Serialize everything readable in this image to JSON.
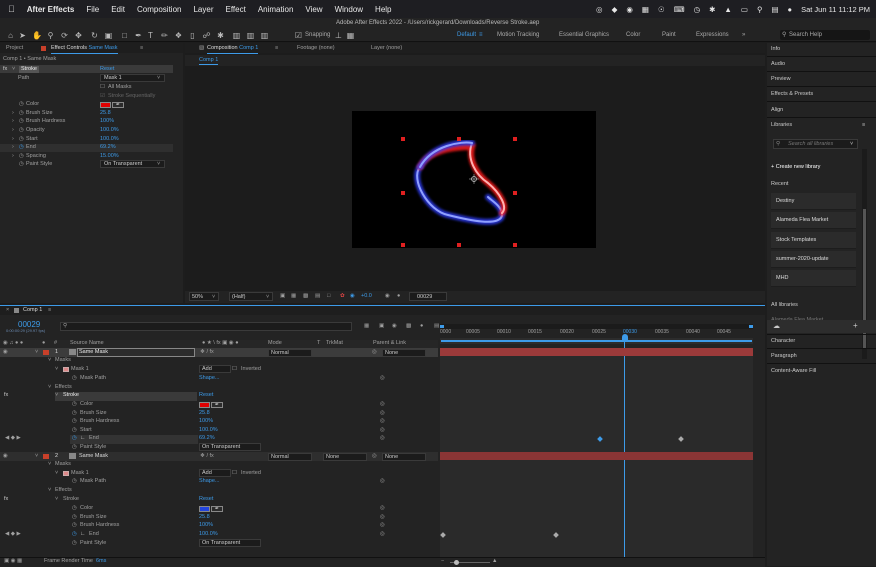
{
  "menubar": {
    "app": "After Effects",
    "items": [
      "File",
      "Edit",
      "Composition",
      "Layer",
      "Effect",
      "Animation",
      "View",
      "Window",
      "Help"
    ],
    "clock": "Sat Jun 11  11:12 PM"
  },
  "window": {
    "title": "Adobe After Effects 2022 - /Users/rickgerard/Downloads/Reverse Stroke.aep"
  },
  "toolbar": {
    "snapping": "Snapping",
    "workspaces": [
      "Default",
      "Motion Tracking",
      "Essential Graphics",
      "Color",
      "Paint",
      "Expressions"
    ],
    "active_workspace": "Default",
    "search_placeholder": "Search Help"
  },
  "effect_controls": {
    "tab_project": "Project",
    "tab_effect": "Effect Controls",
    "tab_effect_layer": "Same Mask",
    "breadcrumb": "Comp 1 • Same Mask",
    "effect_name": "Stroke",
    "reset": "Reset",
    "path_label": "Path",
    "path_value": "Mask 1",
    "all_masks": "All Masks",
    "stroke_seq": "Stroke Sequentially",
    "props": [
      {
        "name": "Color",
        "value": ""
      },
      {
        "name": "Brush Size",
        "value": "25.8"
      },
      {
        "name": "Brush Hardness",
        "value": "100%"
      },
      {
        "name": "Opacity",
        "value": "100.0%"
      },
      {
        "name": "Start",
        "value": "100.0%"
      },
      {
        "name": "End",
        "value": "69.2%"
      },
      {
        "name": "Spacing",
        "value": "15.00%"
      },
      {
        "name": "Paint Style",
        "value": "On Transparent"
      }
    ],
    "color": "#e00000"
  },
  "composition": {
    "tab": "Composition",
    "tab_comp": "Comp 1",
    "tab_footage": "Footage (none)",
    "tab_layer": "Layer (none)",
    "subtab": "Comp 1",
    "zoom": "50%",
    "resolution": "(Half)",
    "exposure": "+0.0",
    "timecode": "00029"
  },
  "right_panel": {
    "items": [
      "Info",
      "Audio",
      "Preview",
      "Effects & Presets",
      "Align",
      "Libraries"
    ],
    "lib_search": "Search all libraries",
    "create": "Create new library",
    "recent": "Recent",
    "libraries": [
      "Destiny",
      "Alameda Flea Market",
      "Stock Templates",
      "summer-2020-update",
      "MHD"
    ],
    "all_libraries": "All libraries",
    "peek": "Alameda Flea Market",
    "bottom": [
      "Character",
      "Paragraph",
      "Content-Aware Fill"
    ]
  },
  "timeline": {
    "tab": "Comp 1",
    "timecode": "00029",
    "fps": "0:00:00:29 (29.97 fps)",
    "headers": {
      "source": "Source Name",
      "mode": "Mode",
      "t": "T",
      "trkmat": "TrkMat",
      "parent": "Parent & Link"
    },
    "ruler": [
      "0000",
      "00005",
      "00010",
      "00015",
      "00020",
      "00025",
      "00030",
      "00035",
      "00040",
      "00045"
    ],
    "layer1": {
      "num": "1",
      "name": "Same Mask",
      "mode": "Normal",
      "parent": "None"
    },
    "layer2": {
      "num": "2",
      "name": "Same Mask",
      "mode": "Normal",
      "trkmat": "None",
      "parent": "None"
    },
    "masks": "Masks",
    "mask1": "Mask 1",
    "add": "Add",
    "inverted": "Inverted",
    "mask_path": "Mask Path",
    "shape": "Shape...",
    "effects": "Effects",
    "stroke": "Stroke",
    "reset": "Reset",
    "l1_props": [
      {
        "name": "Color",
        "value": ""
      },
      {
        "name": "Brush Size",
        "value": "25.8"
      },
      {
        "name": "Brush Hardness",
        "value": "100%"
      },
      {
        "name": "Start",
        "value": "100.0%"
      },
      {
        "name": "End",
        "value": "69.2%"
      },
      {
        "name": "Paint Style",
        "value": "On Transparent"
      }
    ],
    "l2_props": [
      {
        "name": "Color",
        "value": ""
      },
      {
        "name": "Brush Size",
        "value": "25.8"
      },
      {
        "name": "Brush Hardness",
        "value": "100%"
      },
      {
        "name": "End",
        "value": "100.0%"
      },
      {
        "name": "Paint Style",
        "value": "On Transparent"
      }
    ],
    "l1_color": "#e00000",
    "l2_color": "#2244dd",
    "frame_render": "Frame Render Time",
    "frame_render_value": "6ms"
  }
}
